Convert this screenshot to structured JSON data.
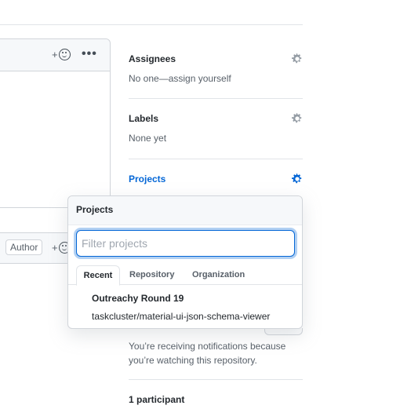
{
  "comments": {
    "reaction_plus": "+",
    "more_label": "•••",
    "author_badge": "Author"
  },
  "sidebar": {
    "assignees": {
      "title": "Assignees",
      "value": "No one—assign yourself"
    },
    "labels": {
      "title": "Labels",
      "value": "None yet"
    },
    "projects": {
      "title": "Projects"
    },
    "notifications_text": "You’re receiving notifications because you’re watching this repository.",
    "participants": "1 participant"
  },
  "projects_dropdown": {
    "header": "Projects",
    "filter_placeholder": "Filter projects",
    "filter_value": "",
    "tabs": [
      "Recent",
      "Repository",
      "Organization"
    ],
    "items": [
      {
        "name": "Outreachy Round 19",
        "repo": "taskcluster/material-ui-json-schema-viewer"
      }
    ]
  },
  "colors": {
    "link_blue": "#0366d6",
    "gear_gray": "#959da5",
    "border": "#d1d5da"
  },
  "icons": [
    "smiley-icon",
    "gear-icon",
    "kebab-icon"
  ]
}
